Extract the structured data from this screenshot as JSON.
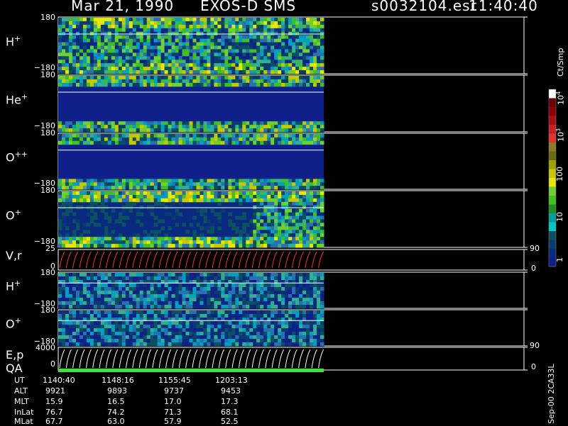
{
  "header": {
    "date": "Mar 21, 1990",
    "instrument": "EXOS-D SMS",
    "file": "s0032104.esr",
    "time": "11:40:40"
  },
  "panels": [
    {
      "label": "H",
      "sup": "+",
      "top_tick": "180",
      "bottom_tick": "−180"
    },
    {
      "label": "He",
      "sup": "+",
      "top_tick": "180",
      "bottom_tick": "−180"
    },
    {
      "label": "O",
      "sup": "++",
      "top_tick": "180",
      "bottom_tick": "−180"
    },
    {
      "label": "O",
      "sup": "+",
      "top_tick": "180",
      "bottom_tick": "−180"
    },
    {
      "label": "V,r",
      "sup": "",
      "top_tick": "25",
      "bottom_tick": "0",
      "right_top": "90",
      "right_bottom": "0"
    },
    {
      "label": "H",
      "sup": "+",
      "top_tick": "180",
      "bottom_tick": "−180"
    },
    {
      "label": "O",
      "sup": "+",
      "top_tick": "180",
      "bottom_tick": "−180"
    },
    {
      "label": "E,p",
      "sup": "",
      "top_tick": "4000",
      "bottom_tick": "0",
      "right_top": "90",
      "right_bottom": "0"
    }
  ],
  "qa_label": "QA",
  "colorbar": {
    "unit": "Ct/Smp",
    "labels": [
      "10",
      "100",
      "10",
      "10",
      "1"
    ],
    "superscripts": [
      "4",
      "",
      "3",
      "",
      ""
    ],
    "colors": [
      "#ffffff",
      "#6b0000",
      "#8b0000",
      "#aa1010",
      "#c82020",
      "#e83030",
      "#8a7a2a",
      "#6a6a10",
      "#a0a000",
      "#c8c800",
      "#e8e800",
      "#70d030",
      "#40c020",
      "#209020",
      "#00a0a0",
      "#00c8c8",
      "#0a5060",
      "#0a3a70",
      "#0a2a80",
      "#10208a"
    ]
  },
  "side_label": "Sep-00 2CA33L",
  "ephemeris": {
    "rows": [
      {
        "name": "UT",
        "values": [
          "1140:40",
          "1148:16",
          "1155:45",
          "1203:13"
        ]
      },
      {
        "name": "ALT",
        "values": [
          "9921",
          "9893",
          "9737",
          "9453"
        ]
      },
      {
        "name": "MLT",
        "values": [
          "15.9",
          "16.5",
          "17.0",
          "17.3"
        ]
      },
      {
        "name": "InLat",
        "values": [
          "76.7",
          "74.2",
          "71.3",
          "68.1"
        ]
      },
      {
        "name": "MLat",
        "values": [
          "67.7",
          "63.0",
          "57.9",
          "52.5"
        ]
      }
    ]
  },
  "chart_data": {
    "type": "heatmap",
    "title": "Mar 21, 1990 EXOS-D SMS",
    "x_ticks": [
      "1140:40",
      "1148:16",
      "1155:45",
      "1203:13"
    ],
    "colorbar_unit": "Ct/Smp",
    "colorbar_ticks": [
      "1",
      "10",
      "100",
      "10^3",
      "10^4"
    ],
    "panels": [
      {
        "name": "H+",
        "ylim": [
          -180,
          180
        ]
      },
      {
        "name": "He+",
        "ylim": [
          -180,
          180
        ]
      },
      {
        "name": "O++",
        "ylim": [
          -180,
          180
        ]
      },
      {
        "name": "O+",
        "ylim": [
          -180,
          180
        ]
      },
      {
        "name": "V,r",
        "ylim": [
          0,
          25
        ],
        "right_ylim": [
          0,
          90
        ]
      },
      {
        "name": "H+",
        "ylim": [
          -180,
          180
        ]
      },
      {
        "name": "O+",
        "ylim": [
          -180,
          180
        ]
      },
      {
        "name": "E,p",
        "ylim": [
          0,
          4000
        ],
        "right_ylim": [
          0,
          90
        ]
      }
    ]
  }
}
